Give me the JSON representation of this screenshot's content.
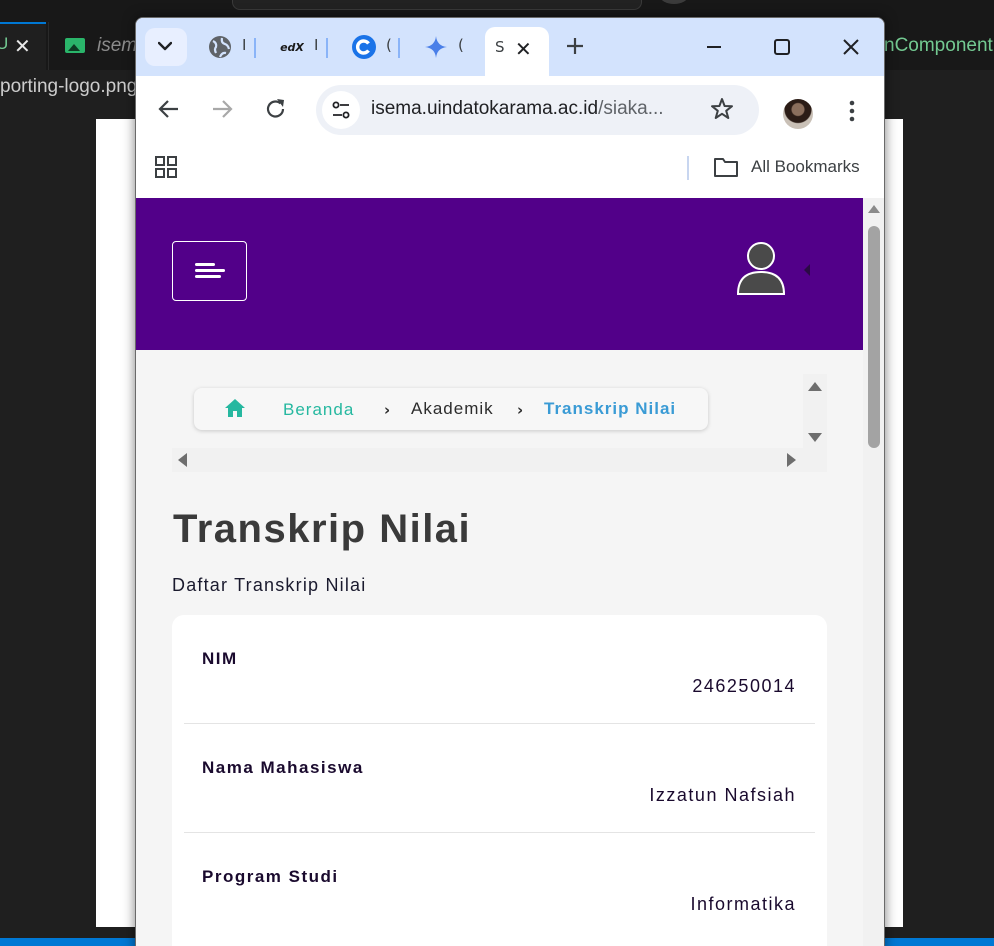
{
  "background_editor": {
    "active_tab_letter": "U",
    "tab2_label": "isem",
    "right_tab_label": "nComponent",
    "file_path_fragment": "porting-logo.png"
  },
  "browser": {
    "tabs": [
      {
        "icon": "globe-icon",
        "title": "I"
      },
      {
        "icon": "edx-icon",
        "title": "I"
      },
      {
        "icon": "chrome-c-icon",
        "title": "("
      },
      {
        "icon": "gemini-star-icon",
        "title": "("
      }
    ],
    "active_tab": {
      "title": "S"
    },
    "url_host": "isema.uindatokarama.ac.id",
    "url_path": "/siaka...",
    "bookmarks_label": "All Bookmarks"
  },
  "page": {
    "header_color": "#520089",
    "breadcrumb": {
      "home": "Beranda",
      "middle": "Akademik",
      "current": "Transkrip Nilai"
    },
    "title": "Transkrip Nilai",
    "subtitle": "Daftar Transkrip Nilai",
    "fields": [
      {
        "label": "NIM",
        "value": "246250014"
      },
      {
        "label": "Nama Mahasiswa",
        "value": "Izzatun Nafsiah"
      },
      {
        "label": "Program Studi",
        "value": "Informatika"
      }
    ]
  },
  "colors": {
    "accent_teal": "#26b8a0",
    "accent_blue": "#3a9bd5",
    "tabstrip": "#d3e3fd"
  }
}
